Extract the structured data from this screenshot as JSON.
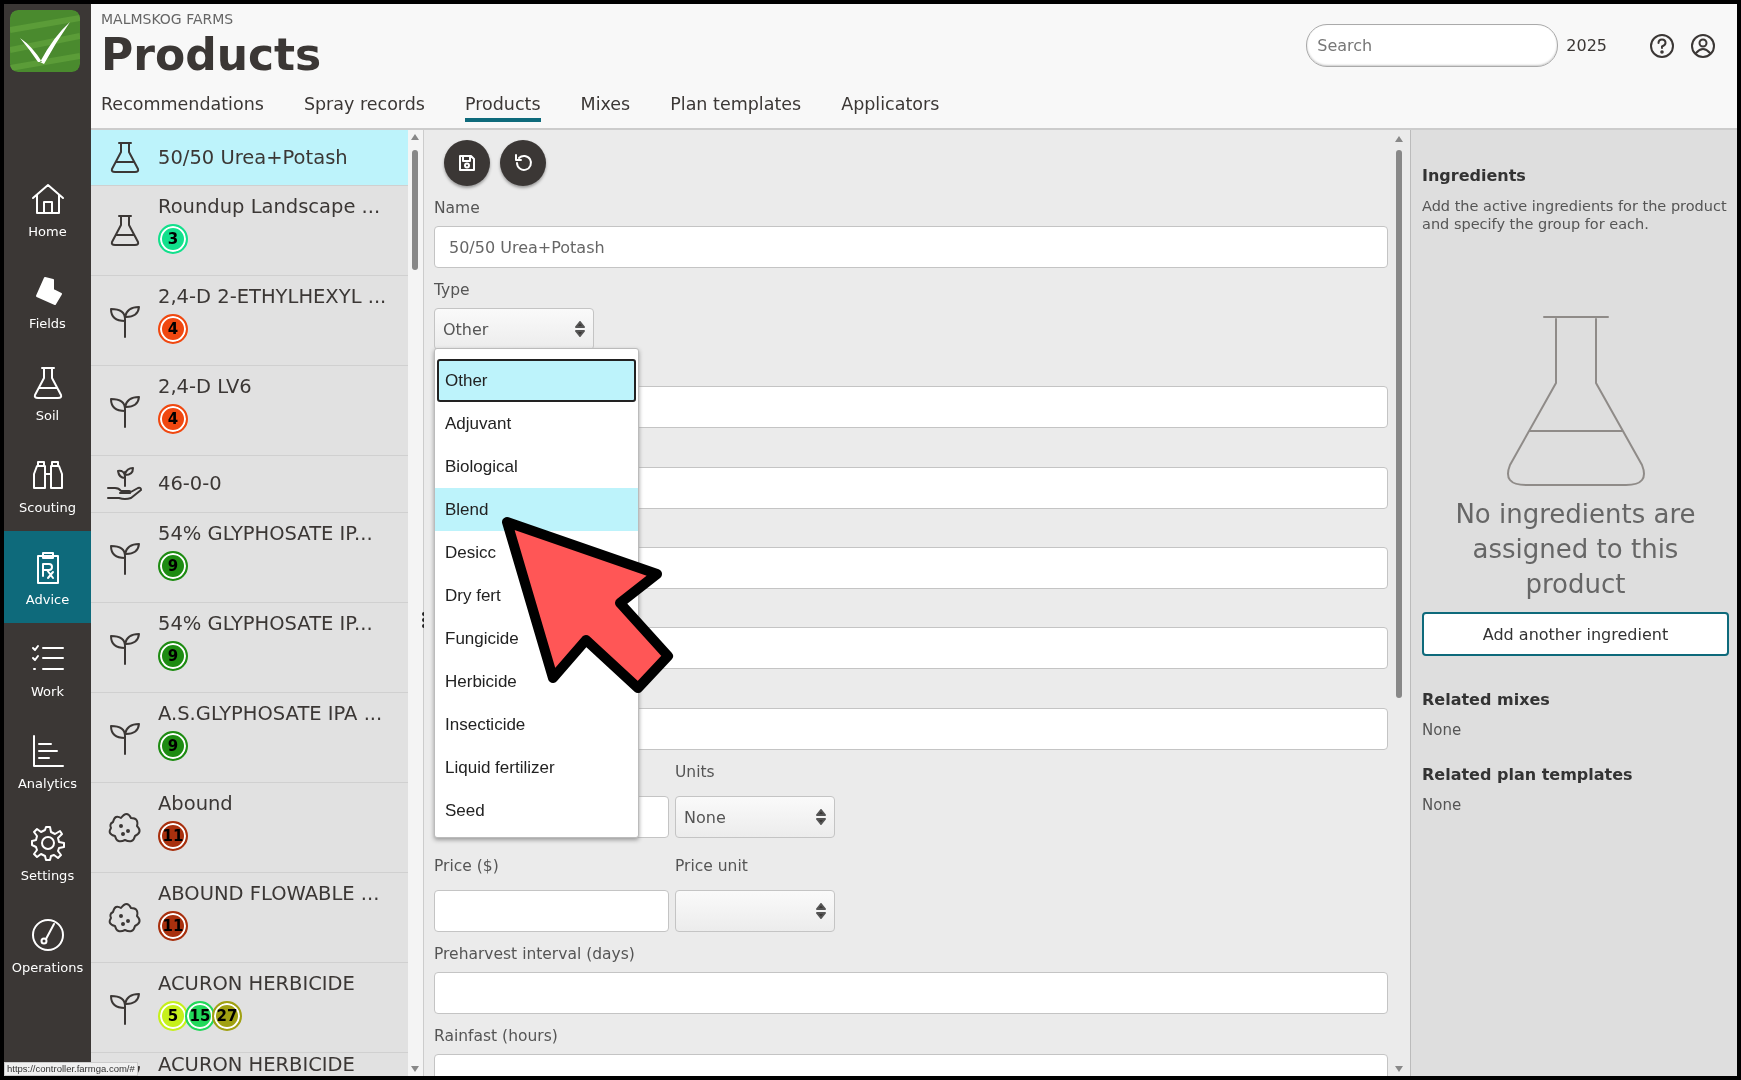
{
  "app": {
    "company": "MALMSKOG FARMS",
    "title": "Products",
    "year": "2025",
    "search": {
      "placeholder": "Search"
    }
  },
  "nav": [
    {
      "label": "Home",
      "selected": false
    },
    {
      "label": "Fields",
      "selected": false
    },
    {
      "label": "Soil",
      "selected": false
    },
    {
      "label": "Scouting",
      "selected": false
    },
    {
      "label": "Advice",
      "selected": true
    },
    {
      "label": "Work",
      "selected": false
    },
    {
      "label": "Analytics",
      "selected": false
    },
    {
      "label": "Settings",
      "selected": false
    },
    {
      "label": "Operations",
      "selected": false
    }
  ],
  "tabs": [
    {
      "label": "Recommendations",
      "selected": false
    },
    {
      "label": "Spray records",
      "selected": false
    },
    {
      "label": "Products",
      "selected": true
    },
    {
      "label": "Mixes",
      "selected": false
    },
    {
      "label": "Plan templates",
      "selected": false
    },
    {
      "label": "Applicators",
      "selected": false
    }
  ],
  "products": [
    {
      "name": "50/50 Urea+Potash",
      "kind": "flask",
      "selected": true
    },
    {
      "name": "Roundup Landscape ...",
      "kind": "flask",
      "selected": false,
      "badges": [
        {
          "text": "3",
          "color": "#12e08c"
        }
      ]
    },
    {
      "name": "2,4-D 2-ETHYLHEXYL ...",
      "kind": "sprout",
      "selected": false,
      "badges": [
        {
          "text": "4",
          "color": "#f04810"
        }
      ]
    },
    {
      "name": "2,4-D LV6",
      "kind": "sprout",
      "selected": false,
      "badges": [
        {
          "text": "4",
          "color": "#f04810"
        }
      ]
    },
    {
      "name": "46-0-0",
      "kind": "hand",
      "selected": false
    },
    {
      "name": "54% GLYPHOSATE IP...",
      "kind": "sprout",
      "selected": false,
      "badges": [
        {
          "text": "9",
          "color": "#1e8c12"
        }
      ]
    },
    {
      "name": "54% GLYPHOSATE IP...",
      "kind": "sprout",
      "selected": false,
      "badges": [
        {
          "text": "9",
          "color": "#1e8c12"
        }
      ]
    },
    {
      "name": "A.S.GLYPHOSATE IPA ...",
      "kind": "sprout",
      "selected": false,
      "badges": [
        {
          "text": "9",
          "color": "#1e8c12"
        }
      ]
    },
    {
      "name": "Abound",
      "kind": "blob",
      "selected": false,
      "badges": [
        {
          "text": "11",
          "color": "#a8300e"
        }
      ]
    },
    {
      "name": "ABOUND FLOWABLE ...",
      "kind": "blob",
      "selected": false,
      "badges": [
        {
          "text": "11",
          "color": "#a8300e"
        }
      ]
    },
    {
      "name": "ACURON HERBICIDE",
      "kind": "sprout",
      "selected": false,
      "badges": [
        {
          "text": "5",
          "color": "#c6f01c"
        },
        {
          "text": "15",
          "color": "#22d85a"
        },
        {
          "text": "27",
          "color": "#a0a012"
        }
      ]
    },
    {
      "name": "ACURON HERBICIDE",
      "kind": "sprout",
      "selected": false
    }
  ],
  "form": {
    "name": {
      "label": "Name",
      "value": "50/50 Urea+Potash"
    },
    "type": {
      "label": "Type",
      "value": "Other",
      "expanded": true,
      "options": [
        {
          "label": "Other",
          "selected": true,
          "highlighted": false
        },
        {
          "label": "Adjuvant",
          "selected": false,
          "highlighted": false
        },
        {
          "label": "Biological",
          "selected": false,
          "highlighted": false
        },
        {
          "label": "Blend",
          "selected": false,
          "highlighted": true
        },
        {
          "label": "Desicc",
          "selected": false,
          "highlighted": false
        },
        {
          "label": "Dry fert",
          "selected": false,
          "highlighted": false
        },
        {
          "label": "Fungicide",
          "selected": false,
          "highlighted": false
        },
        {
          "label": "Herbicide",
          "selected": false,
          "highlighted": false
        },
        {
          "label": "Insecticide",
          "selected": false,
          "highlighted": false
        },
        {
          "label": "Liquid fertilizer",
          "selected": false,
          "highlighted": false
        },
        {
          "label": "Seed",
          "selected": false,
          "highlighted": false
        }
      ]
    },
    "units": {
      "label": "Units",
      "value": "None"
    },
    "price": {
      "label": "Price ($)"
    },
    "price_unit": {
      "label": "Price unit"
    },
    "preharvest": {
      "label": "Preharvest interval (days)"
    },
    "rainfast": {
      "label": "Rainfast (hours)"
    }
  },
  "ingredients": {
    "title": "Ingredients",
    "description": "Add the active ingredients for the product and specify the group for each.",
    "empty_message": "No ingredients are assigned to this product",
    "add_button": "Add another ingredient",
    "related": [
      {
        "title": "Related mixes",
        "value": "None"
      },
      {
        "title": "Related plan templates",
        "value": "None"
      }
    ]
  },
  "status_url": "https://controller.farmga.com/#"
}
